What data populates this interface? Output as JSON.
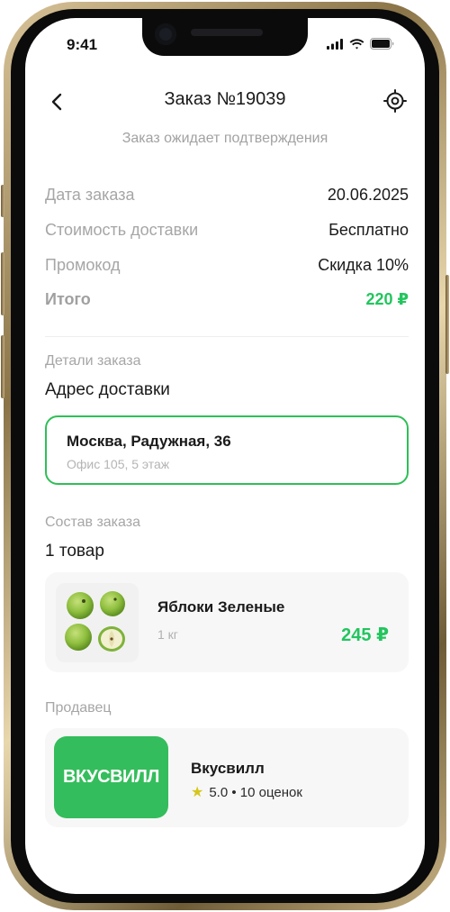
{
  "status_bar": {
    "time": "9:41",
    "icons": [
      "signal-icon",
      "wifi-icon",
      "battery-icon"
    ]
  },
  "header": {
    "title": "Заказ №19039",
    "back_icon": "chevron-left-icon",
    "locate_icon": "locate-icon"
  },
  "order_status": "Заказ ожидает подтверждения",
  "summary": {
    "date_label": "Дата заказа",
    "date_value": "20.06.2025",
    "delivery_label": "Стоимость доставки",
    "delivery_value": "Бесплатно",
    "promo_label": "Промокод",
    "promo_value": "Скидка 10%",
    "total_label": "Итого",
    "total_value": "220 ₽"
  },
  "details": {
    "caption": "Детали заказа",
    "heading": "Адрес доставки",
    "address_main": "Москва, Радужная, 36",
    "address_sub": "Офис 105, 5 этаж"
  },
  "composition": {
    "caption": "Состав заказа",
    "heading": "1 товар",
    "product": {
      "name": "Яблоки Зеленые",
      "quantity": "1 кг",
      "price": "245 ₽"
    }
  },
  "seller": {
    "caption": "Продавец",
    "logo_text": "ВКУСВИЛЛ",
    "name": "Вкусвилл",
    "rating": "5.0 • 10 оценок"
  },
  "colors": {
    "accent_green": "#22c55e",
    "border_green": "#2fbf57",
    "logo_green": "#34bd5c"
  }
}
